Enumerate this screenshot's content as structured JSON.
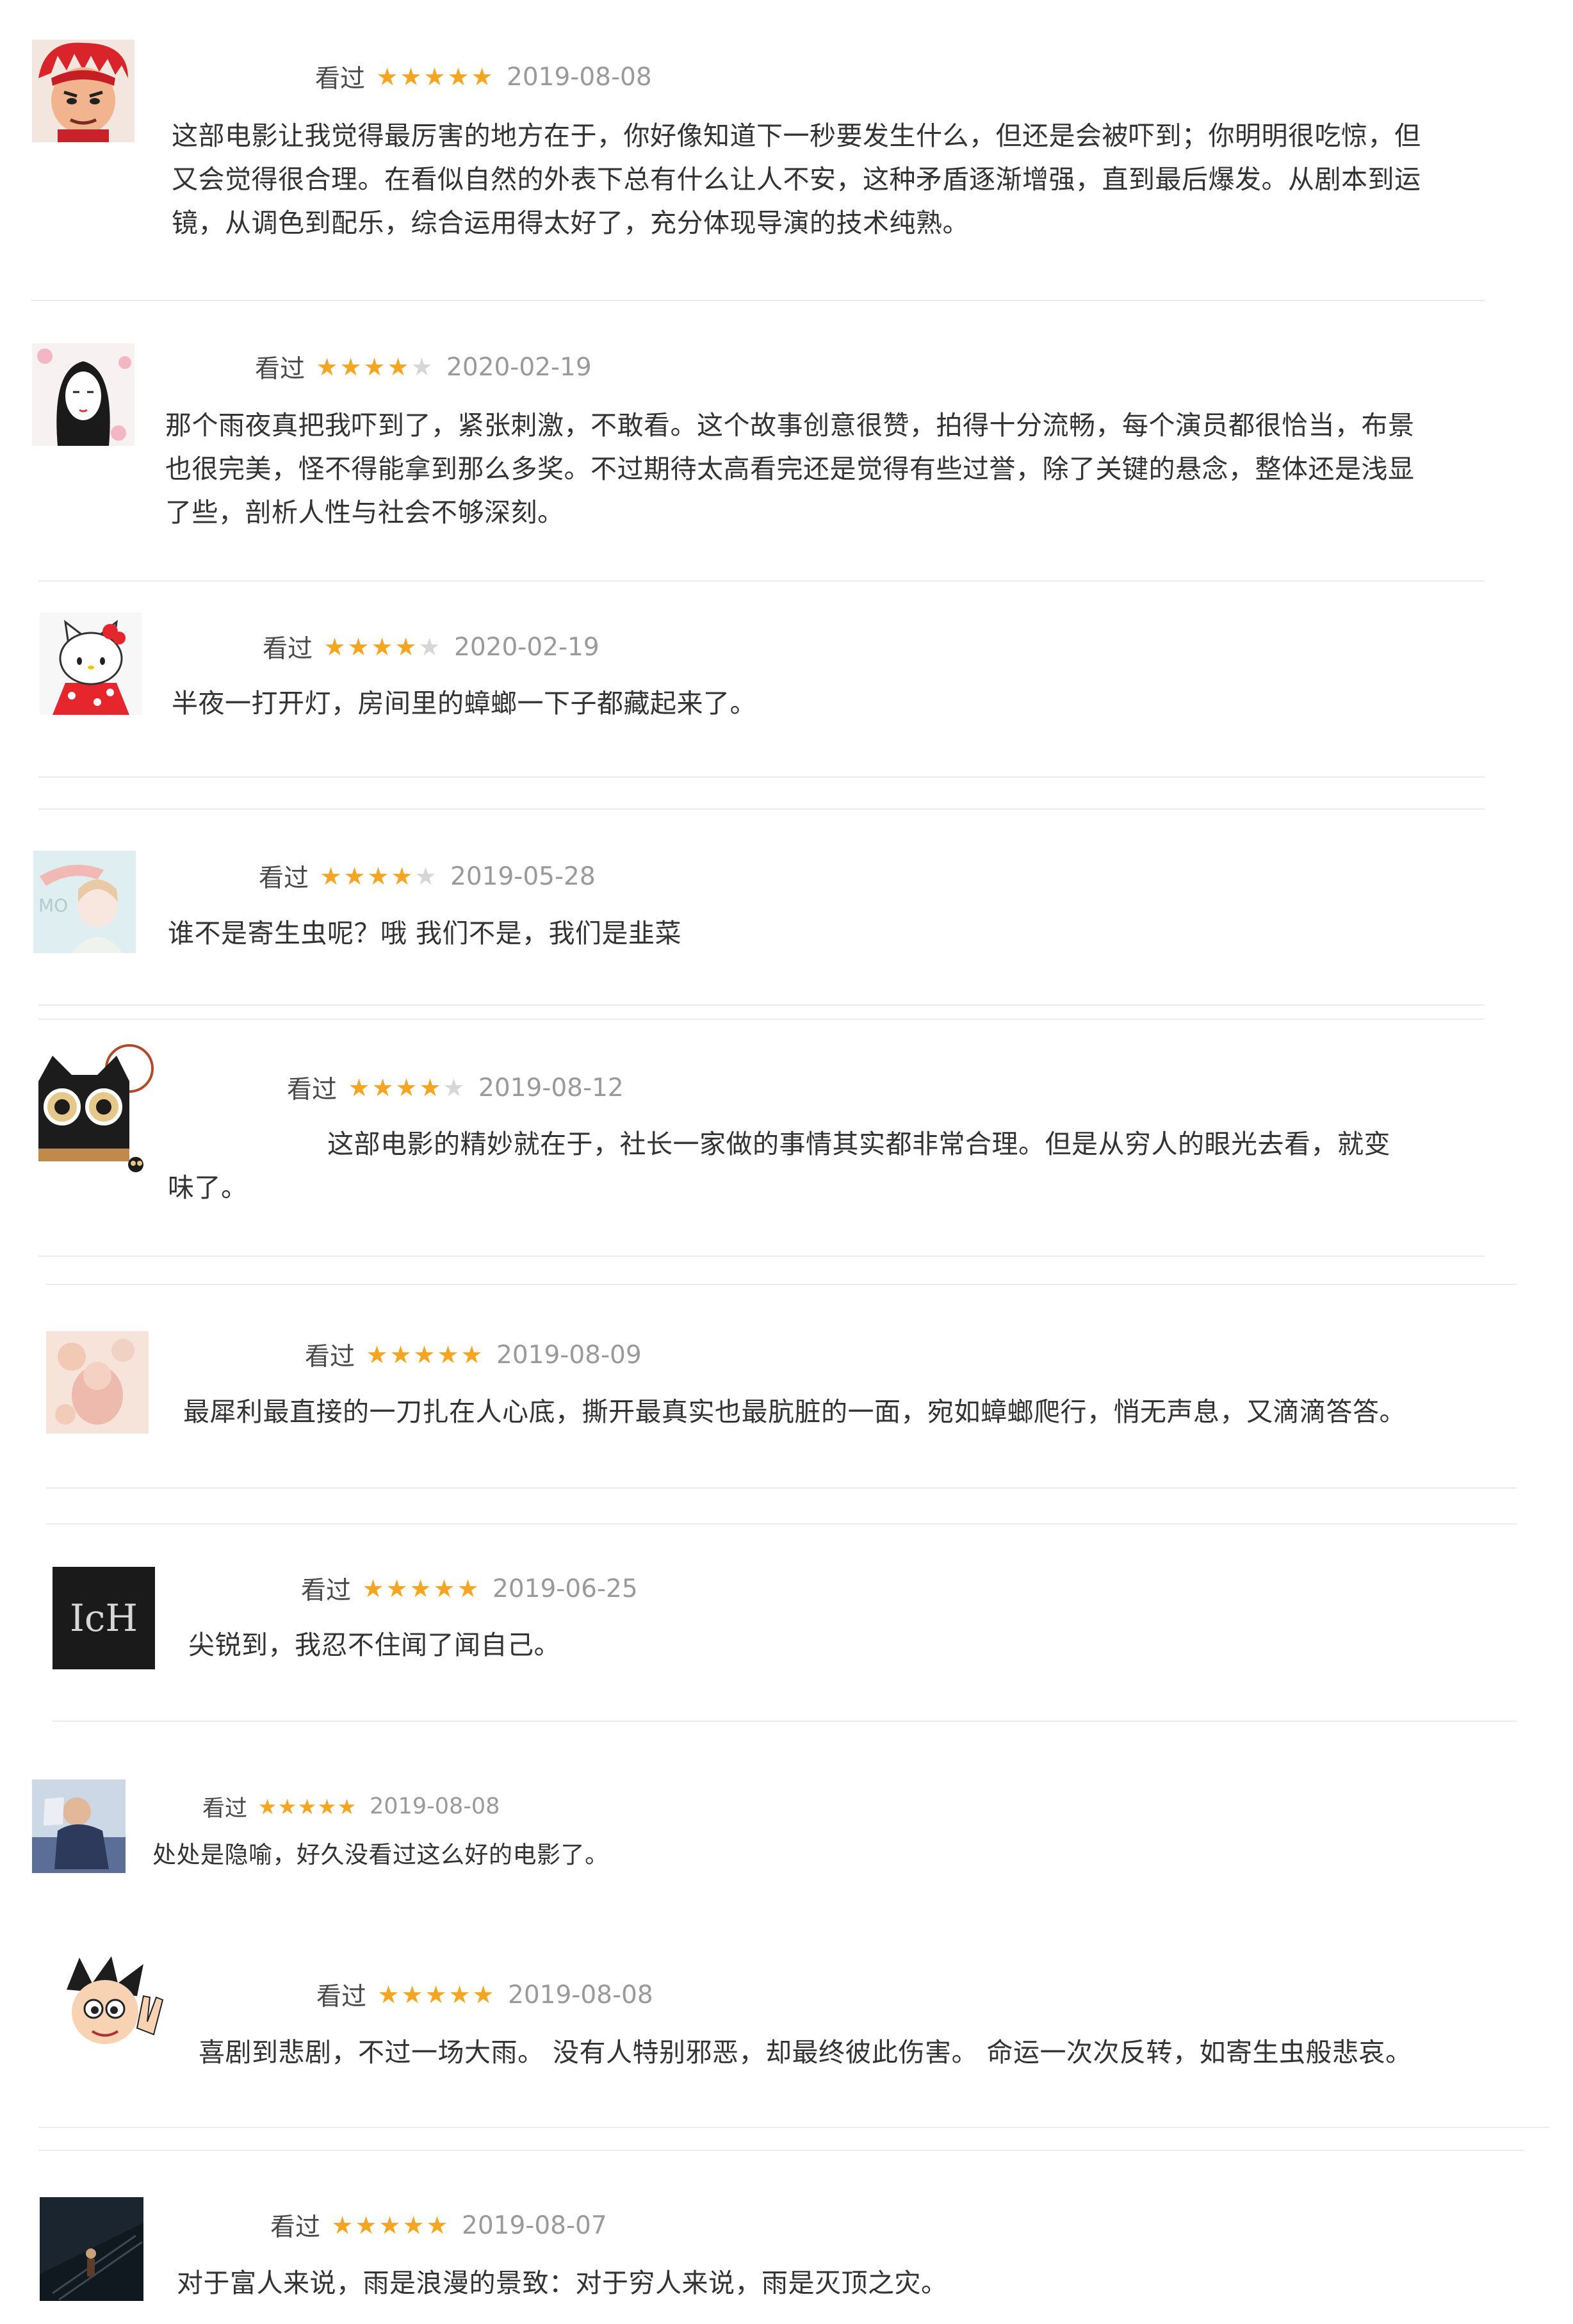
{
  "reviews": [
    {
      "status": "看过",
      "rating": 5,
      "date": "2019-08-08",
      "content": "这部电影让我觉得最厉害的地方在于，你好像知道下一秒要发生什么，但还是会被吓到；你明明很吃惊，但\n又会觉得很合理。在看似自然的外表下总有什么让人不安，这种矛盾逐渐增强，直到最后爆发。从剧本到运\n镜，从调色到配乐，综合运用得太好了，充分体现导演的技术纯熟。",
      "avatar": "red-hair-anime-boy"
    },
    {
      "status": "看过",
      "rating": 4,
      "date": "2020-02-19",
      "content": "那个雨夜真把我吓到了，紧张刺激，不敢看。这个故事创意很赞，拍得十分流畅，每个演员都很恰当，布景\n也很完美，怪不得能拿到那么多奖。不过期待太高看完还是觉得有些过誉，除了关键的悬念，整体还是浅显\n了些，剖析人性与社会不够深刻。",
      "avatar": "long-hair-girl-sketch"
    },
    {
      "status": "看过",
      "rating": 4,
      "date": "2020-02-19",
      "content": "半夜一打开灯，房间里的蟑螂一下子都藏起来了。",
      "avatar": "hello-kitty"
    },
    {
      "status": "看过",
      "rating": 4,
      "date": "2019-05-28",
      "content": "谁不是寄生虫呢？哦 我们不是，我们是韭菜",
      "avatar": "pastel-girl"
    },
    {
      "status": "看过",
      "rating": 4,
      "date": "2019-08-12",
      "content": "　　　　　　这部电影的精妙就在于，社长一家做的事情其实都非常合理。但是从穷人的眼光去看，就变\n味了。",
      "avatar": "black-cat-owl-eyes"
    },
    {
      "status": "看过",
      "rating": 5,
      "date": "2019-08-09",
      "content": "最犀利最直接的一刀扎在人心底，撕开最真实也最肮脏的一面，宛如蟑螂爬行，悄无声息，又滴滴答答。",
      "avatar": "faded-pink-figure"
    },
    {
      "status": "看过",
      "rating": 5,
      "date": "2019-06-25",
      "content": "尖锐到，我忍不住闻了闻自己。",
      "avatar": "dark-ich-logo",
      "avatar_text": "IcH"
    },
    {
      "status": "看过",
      "rating": 5,
      "date": "2019-08-08",
      "content": "处处是隐喻，好久没看过这么好的电影了。",
      "avatar": "chubby-person-photo"
    },
    {
      "status": "看过",
      "rating": 5,
      "date": "2019-08-08",
      "content": "喜剧到悲剧，不过一场大雨。 没有人特别邪恶，却最终彼此伤害。 命运一次次反转，如寄生虫般悲哀。",
      "avatar": "astro-boy-peace"
    },
    {
      "status": "看过",
      "rating": 5,
      "date": "2019-08-07",
      "content": "对于富人来说，雨是浪漫的景致：对于穷人来说，雨是灭顶之灾。",
      "avatar": "dark-stairs-photo"
    }
  ],
  "colors": {
    "star_on": "#f4a623",
    "star_off": "#d6d6d6",
    "date": "#9a9a9a",
    "text": "#333333"
  }
}
